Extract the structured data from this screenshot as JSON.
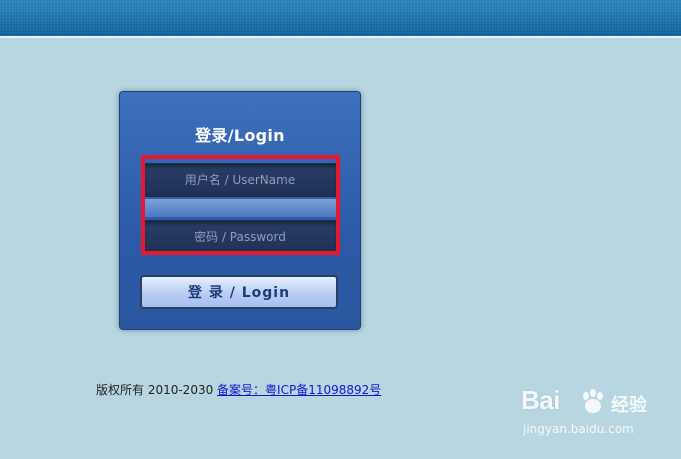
{
  "login": {
    "title": "登录/Login",
    "username_placeholder": "用户名 / UserName",
    "password_placeholder": "密码 / Password",
    "button_label": "登 录 / Login"
  },
  "footer": {
    "copyright": "版权所有 2010-2030 ",
    "icp_link": "备案号：粤ICP备11098892号"
  },
  "watermark": {
    "brand": "Bai",
    "brand_suffix": "经验",
    "url": "jingyan.baidu.com"
  },
  "colors": {
    "page_bg": "#b7d6e1",
    "header_blue": "#0d5f96",
    "panel_blue": "#2c5aa6",
    "highlight_red": "#e5192e",
    "link_blue": "#1414d0"
  }
}
